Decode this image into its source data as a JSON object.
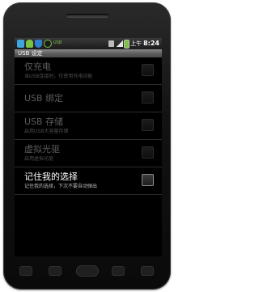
{
  "status_bar": {
    "debug_tag": "USB",
    "network_label": "上午",
    "time": "8:24"
  },
  "title_bar": {
    "title": "USB 设定"
  },
  "options": [
    {
      "label": "仅充电",
      "sublabel": "当USB连接时，仅使用充电功能",
      "enabled": false,
      "checked": false
    },
    {
      "label": "USB 绑定",
      "sublabel": "",
      "enabled": false,
      "checked": false
    },
    {
      "label": "USB 存储",
      "sublabel": "启用USB大容量存储",
      "enabled": false,
      "checked": false
    },
    {
      "label": "虚拟光驱",
      "sublabel": "启用虚拟光驱",
      "enabled": false,
      "checked": false
    },
    {
      "label": "记住我的选择",
      "sublabel": "记住我的选择，下次不要自动弹出",
      "enabled": true,
      "checked": false
    }
  ],
  "colors": {
    "background": "#000000",
    "enabled_text": "#ffffff",
    "disabled_text": "#5c5c5c",
    "title_bar": "#6b6b6b"
  },
  "icons": [
    "usb-icon",
    "android-icon",
    "shield-icon",
    "debug-icon",
    "sim-icon",
    "signal-icon",
    "battery-icon"
  ]
}
